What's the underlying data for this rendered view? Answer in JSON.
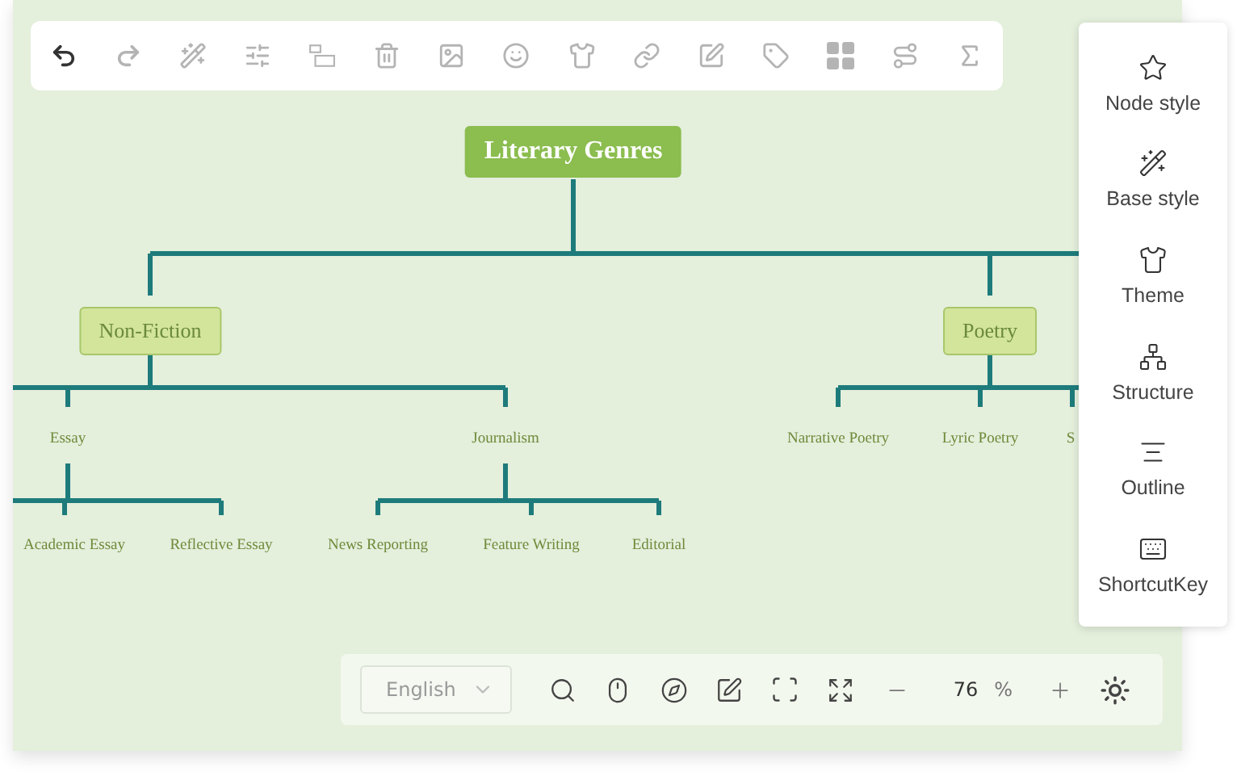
{
  "toolbar": [
    {
      "kind": "undo",
      "disabled": false
    },
    {
      "kind": "redo",
      "disabled": true
    },
    {
      "kind": "wand",
      "disabled": true
    },
    {
      "kind": "sliders",
      "disabled": true
    },
    {
      "kind": "node",
      "disabled": true
    },
    {
      "kind": "trash",
      "disabled": true
    },
    {
      "kind": "image",
      "disabled": true
    },
    {
      "kind": "smile",
      "disabled": true
    },
    {
      "kind": "shirt",
      "disabled": true
    },
    {
      "kind": "link",
      "disabled": true
    },
    {
      "kind": "note",
      "disabled": true
    },
    {
      "kind": "tag",
      "disabled": true
    },
    {
      "kind": "grid",
      "disabled": true
    },
    {
      "kind": "route",
      "disabled": true
    },
    {
      "kind": "formula",
      "disabled": true
    }
  ],
  "mindmap": {
    "label": "Literary Genres",
    "children": [
      {
        "label": "Non-Fiction",
        "children": [
          {
            "label": "Essay",
            "children": [
              {
                "label": "Academic Essay"
              },
              {
                "label": "Reflective Essay"
              }
            ]
          },
          {
            "label": "Journalism",
            "children": [
              {
                "label": "News Reporting"
              },
              {
                "label": "Feature Writing"
              },
              {
                "label": "Editorial"
              }
            ]
          }
        ]
      },
      {
        "label": "Poetry",
        "children": [
          {
            "label": "Narrative Poetry"
          },
          {
            "label": "Lyric Poetry"
          },
          {
            "label": "S"
          }
        ]
      }
    ]
  },
  "side_panel": [
    {
      "kind": "node_style",
      "label": "Node style"
    },
    {
      "kind": "base_style",
      "label": "Base style"
    },
    {
      "kind": "theme",
      "label": "Theme"
    },
    {
      "kind": "structure",
      "label": "Structure"
    },
    {
      "kind": "outline",
      "label": "Outline"
    },
    {
      "kind": "shortcut",
      "label": "ShortcutKey"
    }
  ],
  "bottom_bar": {
    "language": "English",
    "zoom": "76",
    "zoom_unit": "%"
  }
}
